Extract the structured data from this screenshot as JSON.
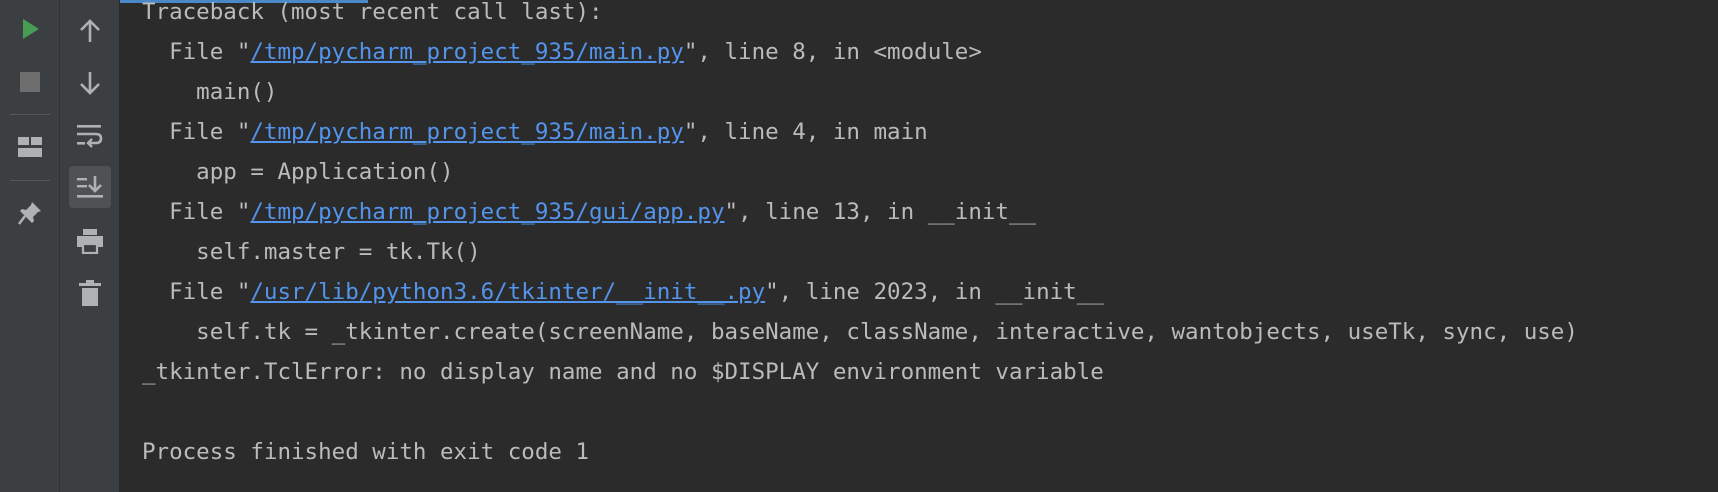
{
  "toolbar": {
    "run_icon": "run-icon",
    "stop_icon": "stop-icon",
    "layout_icon": "layout-icon",
    "pin_icon": "pin-icon",
    "up_icon": "arrow-up-icon",
    "down_icon": "arrow-down-icon",
    "wrap_icon": "soft-wrap-icon",
    "scroll_end_icon": "scroll-to-end-icon",
    "print_icon": "print-icon",
    "trash_icon": "trash-icon"
  },
  "colors": {
    "background": "#2b2b2b",
    "toolbar": "#3c3f41",
    "text": "#bbbbbb",
    "link": "#5394ec",
    "run_green": "#499c54"
  },
  "console": {
    "lines": [
      {
        "text": "Traceback (most recent call last):"
      },
      {
        "prefix": "  File \"",
        "link": "/tmp/pycharm_project_935/main.py",
        "suffix": "\", line 8, in <module>"
      },
      {
        "text": "    main()"
      },
      {
        "prefix": "  File \"",
        "link": "/tmp/pycharm_project_935/main.py",
        "suffix": "\", line 4, in main"
      },
      {
        "text": "    app = Application()"
      },
      {
        "prefix": "  File \"",
        "link": "/tmp/pycharm_project_935/gui/app.py",
        "suffix": "\", line 13, in __init__"
      },
      {
        "text": "    self.master = tk.Tk()"
      },
      {
        "prefix": "  File \"",
        "link": "/usr/lib/python3.6/tkinter/__init__.py",
        "suffix": "\", line 2023, in __init__"
      },
      {
        "text": "    self.tk = _tkinter.create(screenName, baseName, className, interactive, wantobjects, useTk, sync, use)"
      },
      {
        "text": "_tkinter.TclError: no display name and no $DISPLAY environment variable"
      },
      {
        "text": ""
      },
      {
        "text": "Process finished with exit code 1"
      }
    ]
  }
}
